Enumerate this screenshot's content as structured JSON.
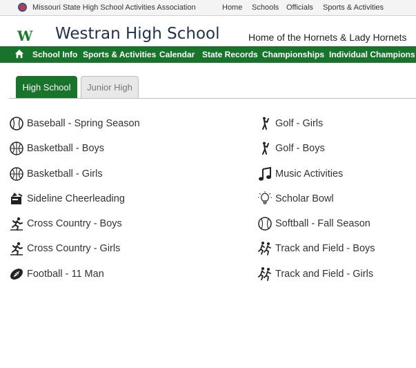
{
  "topbar": {
    "org_name": "Missouri State High School Activities Association",
    "links": [
      "Home",
      "Schools",
      "Officials",
      "Sports & Activities"
    ]
  },
  "header": {
    "logo_letter": "W",
    "school_name": "Westran High School",
    "tagline": "Home of the Hornets & Lady Hornets"
  },
  "nav": {
    "home_icon": "home-icon",
    "items": [
      "School Info",
      "Sports & Activities",
      "Calendar",
      "State Records",
      "Championships",
      "Individual Champions"
    ]
  },
  "tabs": [
    {
      "label": "High School",
      "active": true
    },
    {
      "label": "Junior High",
      "active": false
    }
  ],
  "activities_left": [
    {
      "label": "Baseball - Spring Season",
      "icon": "baseball-icon"
    },
    {
      "label": "Basketball - Boys",
      "icon": "basketball-icon"
    },
    {
      "label": "Basketball - Girls",
      "icon": "basketball-icon"
    },
    {
      "label": "Sideline Cheerleading",
      "icon": "megaphone-icon"
    },
    {
      "label": "Cross Country - Boys",
      "icon": "runner-icon"
    },
    {
      "label": "Cross Country - Girls",
      "icon": "runner-icon"
    },
    {
      "label": "Football - 11 Man",
      "icon": "football-icon"
    }
  ],
  "activities_right": [
    {
      "label": "Golf - Girls",
      "icon": "golfer-icon"
    },
    {
      "label": "Golf - Boys",
      "icon": "golfer-icon"
    },
    {
      "label": "Music Activities",
      "icon": "music-note-icon"
    },
    {
      "label": "Scholar Bowl",
      "icon": "lightbulb-icon"
    },
    {
      "label": "Softball - Fall Season",
      "icon": "softball-icon"
    },
    {
      "label": "Track and Field - Boys",
      "icon": "track-runners-icon"
    },
    {
      "label": "Track and Field - Girls",
      "icon": "track-runners-icon"
    }
  ],
  "colors": {
    "nav_green": "#17742a",
    "title_navy": "#23334a"
  }
}
